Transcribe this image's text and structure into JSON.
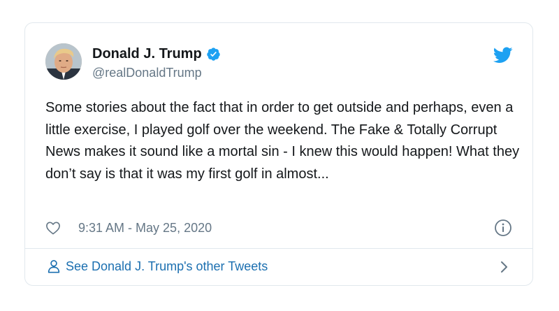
{
  "tweet": {
    "author_name": "Donald J. Trump",
    "author_handle": "@realDonaldTrump",
    "text": "Some stories about the fact that in order to get outside and perhaps, even a little exercise, I played golf over the weekend. The Fake & Totally Corrupt News makes it sound like a mortal sin - I knew this would happen! What they don’t say is that it was my first golf in almost...",
    "timestamp": "9:31 AM - May 25, 2020",
    "verified": true,
    "footer_link": "See Donald J. Trump's other Tweets"
  },
  "icons": {
    "avatar": "profile-photo",
    "verified": "verified-badge-icon",
    "brand": "twitter-bird-icon",
    "like": "heart-outline-icon",
    "info": "info-circle-icon",
    "person": "person-outline-icon",
    "chevron": "chevron-right-icon"
  },
  "colors": {
    "twitter_blue": "#1da1f2",
    "link_blue": "#1b6fb0",
    "secondary_text": "#657786",
    "border": "#e1e8ed",
    "primary_text": "#14171a"
  }
}
